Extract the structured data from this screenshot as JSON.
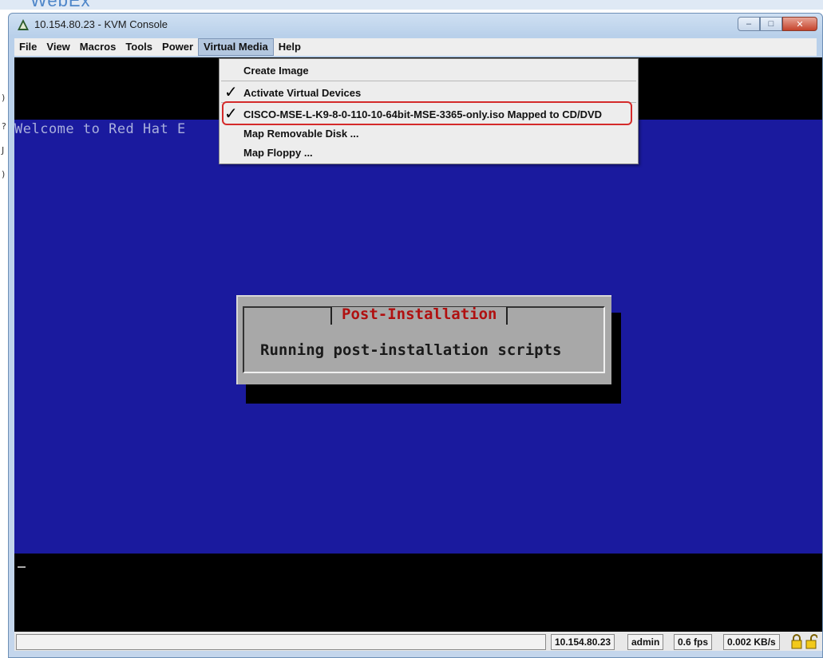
{
  "background": {
    "brand_text": "WebEx"
  },
  "window": {
    "title": "10.154.80.23 - KVM Console",
    "title_icon": "warning-triangle-icon",
    "controls": {
      "minimize": "–",
      "maximize": "□",
      "close": "✕"
    }
  },
  "menubar": {
    "items": [
      "File",
      "View",
      "Macros",
      "Tools",
      "Power",
      "Virtual Media",
      "Help"
    ],
    "active": "Virtual Media"
  },
  "virtual_media_menu": {
    "items": [
      {
        "label": "Create Image",
        "checked": false
      },
      {
        "label": "Activate Virtual Devices",
        "checked": true
      },
      {
        "label": "CISCO-MSE-L-K9-8-0-110-10-64bit-MSE-3365-only.iso Mapped to CD/DVD",
        "checked": true,
        "highlighted": true
      },
      {
        "label": "Map Removable Disk ...",
        "checked": false
      },
      {
        "label": "Map Floppy ...",
        "checked": false
      }
    ],
    "check_glyph": "✓"
  },
  "console": {
    "welcome_line": "Welcome to Red Hat E",
    "dialog": {
      "title": "Post-Installation",
      "message": "Running post-installation scripts"
    },
    "colors": {
      "blue": "#1a1a9e",
      "dialog_title": "#b01010"
    }
  },
  "statusbar": {
    "host": "10.154.80.23",
    "user": "admin",
    "fps": "0.6 fps",
    "rate": "0.002 KB/s",
    "icons": [
      "lock-closed-icon",
      "lock-open-icon"
    ]
  }
}
